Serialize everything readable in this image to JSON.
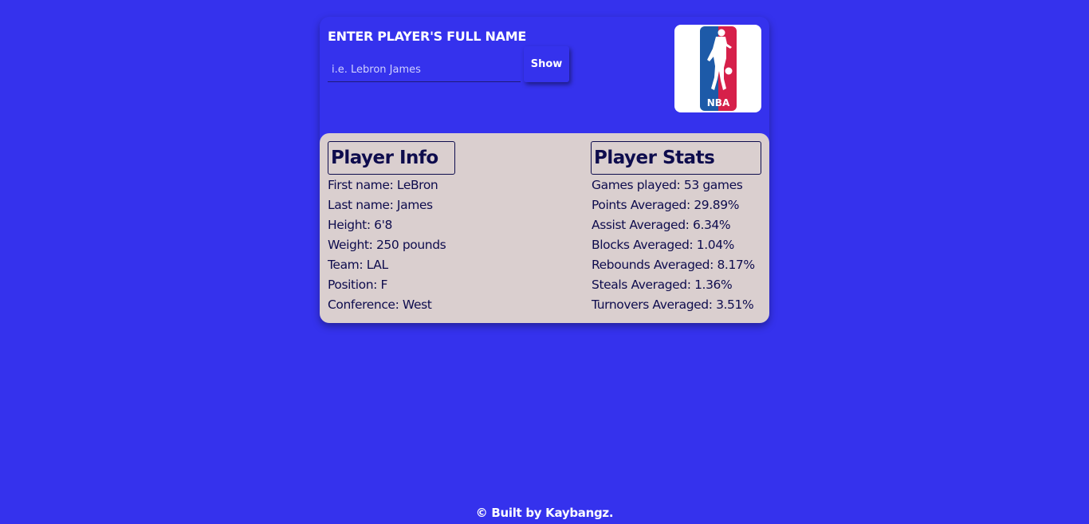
{
  "search": {
    "title": "ENTER PLAYER'S FULL NAME",
    "placeholder": "i.e. Lebron James",
    "value": "",
    "button_label": "Show"
  },
  "logo": {
    "icon": "nba-logo",
    "text": "NBA",
    "colors": {
      "blue": "#1d5aa8",
      "red": "#d6204a"
    }
  },
  "player_info": {
    "heading": "Player Info",
    "items": [
      "First name: LeBron",
      "Last name: James",
      "Height: 6'8",
      "Weight: 250 pounds",
      "Team: LAL",
      "Position: F",
      "Conference: West"
    ]
  },
  "player_stats": {
    "heading": "Player Stats",
    "items": [
      "Games played: 53 games",
      "Points Averaged: 29.89%",
      "Assist Averaged: 6.34%",
      "Blocks Averaged: 1.04%",
      "Rebounds Averaged: 8.17%",
      "Steals Averaged: 1.36%",
      "Turnovers Averaged: 3.51%"
    ]
  },
  "footer": {
    "text": "© Built by Kaybangz."
  },
  "theme": {
    "background": "#3532ed",
    "panel": "#dacfcf",
    "text_dark": "#0e0c4d"
  }
}
